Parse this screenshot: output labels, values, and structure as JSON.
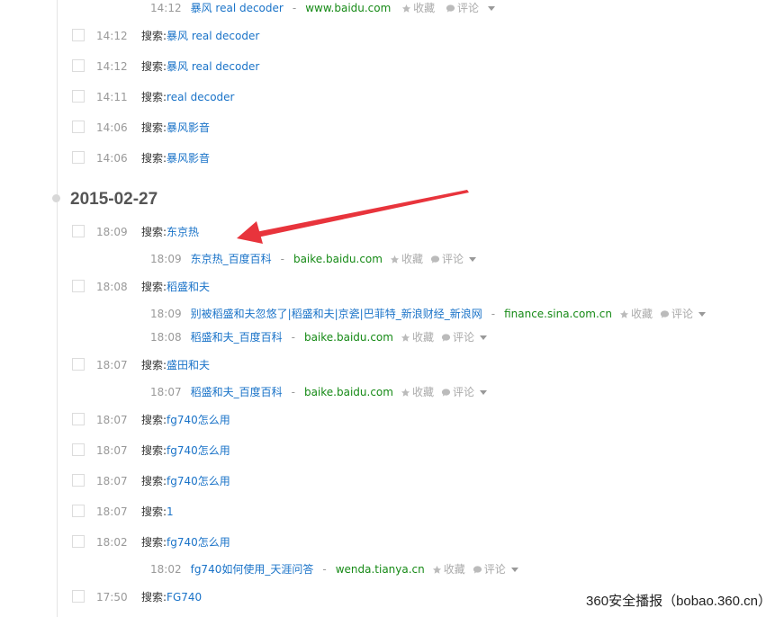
{
  "search_prefix": "搜索:",
  "actions": {
    "favorite": "收藏",
    "comment": "评论"
  },
  "date_heading": "2015-02-27",
  "top_sub": {
    "time": "14:12",
    "title": "暴风 real decoder",
    "sep": "-",
    "domain": "www.baidu.com"
  },
  "queries_before": [
    {
      "time": "14:12",
      "keyword": "暴风 real decoder"
    },
    {
      "time": "14:12",
      "keyword": "暴风 real decoder"
    },
    {
      "time": "14:11",
      "keyword": "real decoder"
    },
    {
      "time": "14:06",
      "keyword": "暴风影音"
    },
    {
      "time": "14:06",
      "keyword": "暴风影音"
    }
  ],
  "queries_after": [
    {
      "time": "18:09",
      "keyword": "东京热",
      "results": [
        {
          "time": "18:09",
          "title": "东京热_百度百科",
          "domain": "baike.baidu.com"
        }
      ]
    },
    {
      "time": "18:08",
      "keyword": "稻盛和夫",
      "results": [
        {
          "time": "18:09",
          "title": "别被稻盛和夫忽悠了|稻盛和夫|京瓷|巴菲特_新浪财经_新浪网",
          "domain": "finance.sina.com.cn"
        },
        {
          "time": "18:08",
          "title": "稻盛和夫_百度百科",
          "domain": "baike.baidu.com"
        }
      ]
    },
    {
      "time": "18:07",
      "keyword": "盛田和夫",
      "results": [
        {
          "time": "18:07",
          "title": "稻盛和夫_百度百科",
          "domain": "baike.baidu.com"
        }
      ]
    },
    {
      "time": "18:07",
      "keyword": "fg740怎么用"
    },
    {
      "time": "18:07",
      "keyword": "fg740怎么用"
    },
    {
      "time": "18:07",
      "keyword": "fg740怎么用"
    },
    {
      "time": "18:07",
      "keyword": "1"
    },
    {
      "time": "18:02",
      "keyword": "fg740怎么用",
      "results": [
        {
          "time": "18:02",
          "title": "fg740如何使用_天涯问答",
          "domain": "wenda.tianya.cn"
        }
      ]
    },
    {
      "time": "17:50",
      "keyword": "FG740"
    }
  ],
  "watermark": "360安全播报（bobao.360.cn）",
  "colors": {
    "link": "#1a73c8",
    "domain": "#168a16",
    "muted": "#999999",
    "arrow": "#e8343c"
  }
}
